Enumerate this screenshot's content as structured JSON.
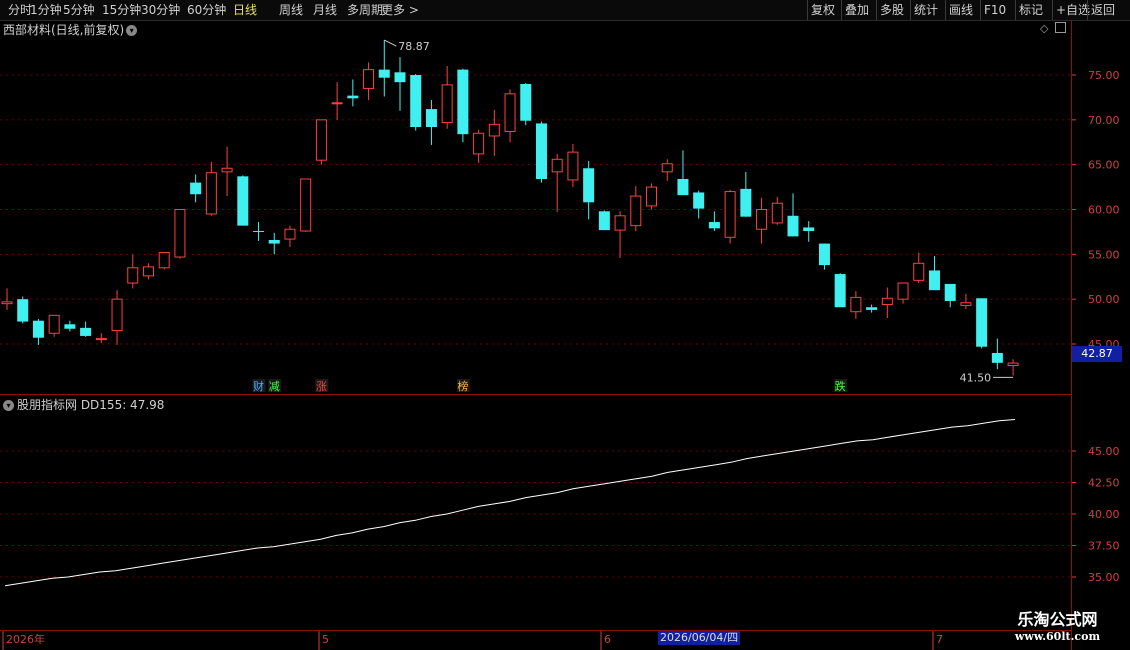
{
  "toolbar": {
    "periods": [
      "分时",
      "1分钟",
      "5分钟",
      "15分钟",
      "30分钟",
      "60分钟",
      "日线",
      "周线",
      "月线",
      "多周期",
      "更多 >"
    ],
    "active_period": "日线",
    "right_buttons": [
      "复权",
      "叠加",
      "多股",
      "统计",
      "画线",
      "F10",
      "标记",
      "+自选",
      "返回"
    ]
  },
  "stock_title": "西部材料(日线,前复权)",
  "indicator_title": "股朋指标网 DD155: 47.98",
  "current_price_tag": "42.87",
  "colors": {
    "up": "#ff4040",
    "down": "#40f0f0",
    "grid": "#6a0000",
    "axis_text": "#d04040",
    "line": "#ffffff"
  },
  "price_axis": {
    "ticks": [
      "75.00",
      "70.00",
      "65.00",
      "60.00",
      "55.00",
      "50.00",
      "45.00"
    ]
  },
  "indicator_axis": {
    "ticks": [
      "45.00",
      "42.50",
      "40.00",
      "37.50",
      "35.00"
    ]
  },
  "date_axis": {
    "labels": [
      "2026年",
      "5",
      "6",
      "7"
    ],
    "cursor_date": "2026/06/04/四"
  },
  "markers": {
    "high": "78.87",
    "low": "41.50"
  },
  "events": [
    {
      "label": "财",
      "index": 16,
      "color": "#40b0ff"
    },
    {
      "label": "减",
      "index": 17,
      "color": "#40ff40"
    },
    {
      "label": "涨",
      "index": 20,
      "color": "#ff4040"
    },
    {
      "label": "榜",
      "index": 29,
      "color": "#ffb040"
    },
    {
      "label": "跌",
      "index": 53,
      "color": "#40ff40"
    }
  ],
  "watermark": {
    "line1": "乐淘公式网",
    "line2": "www.60lt.com"
  },
  "chart_data": {
    "type": "candlestick",
    "title": "西部材料(日线,前复权)",
    "price_range": [
      41.0,
      79.5
    ],
    "ohlc": [
      [
        49.5,
        51.2,
        48.8,
        49.7
      ],
      [
        50.0,
        50.3,
        47.3,
        47.5
      ],
      [
        47.6,
        47.8,
        44.9,
        45.7
      ],
      [
        46.2,
        48.1,
        45.8,
        48.2
      ],
      [
        47.2,
        47.6,
        46.4,
        46.7
      ],
      [
        46.8,
        47.5,
        45.8,
        45.9
      ],
      [
        45.6,
        46.2,
        45.1,
        45.6
      ],
      [
        46.5,
        51.0,
        44.9,
        50.0
      ],
      [
        51.8,
        55.0,
        51.2,
        53.5
      ],
      [
        52.6,
        54.0,
        52.2,
        53.6
      ],
      [
        53.5,
        55.1,
        53.3,
        55.2
      ],
      [
        54.7,
        60.0,
        54.5,
        60.0
      ],
      [
        63.0,
        63.9,
        60.8,
        61.7
      ],
      [
        59.5,
        65.3,
        59.3,
        64.1
      ],
      [
        64.2,
        67.0,
        61.5,
        64.6
      ],
      [
        63.7,
        63.8,
        58.2,
        58.2
      ],
      [
        57.6,
        58.6,
        56.5,
        57.5
      ],
      [
        56.6,
        57.4,
        55.0,
        56.2
      ],
      [
        56.7,
        58.2,
        55.8,
        57.8
      ],
      [
        57.6,
        63.4,
        57.5,
        63.4
      ],
      [
        65.5,
        70.0,
        65.0,
        70.0
      ],
      [
        71.9,
        74.2,
        70.0,
        71.9
      ],
      [
        72.7,
        74.5,
        71.5,
        72.4
      ],
      [
        73.5,
        76.4,
        72.2,
        75.6
      ],
      [
        75.6,
        78.9,
        72.6,
        74.7
      ],
      [
        75.3,
        77.0,
        71.0,
        74.2
      ],
      [
        75.0,
        75.1,
        68.8,
        69.2
      ],
      [
        71.2,
        72.2,
        67.2,
        69.2
      ],
      [
        69.7,
        76.0,
        69.0,
        73.9
      ],
      [
        75.6,
        75.7,
        67.5,
        68.4
      ],
      [
        66.2,
        68.9,
        65.2,
        68.5
      ],
      [
        68.2,
        71.1,
        66.0,
        69.5
      ],
      [
        68.7,
        73.4,
        67.5,
        72.9
      ],
      [
        74.0,
        74.1,
        69.4,
        69.9
      ],
      [
        69.6,
        69.8,
        63.0,
        63.4
      ],
      [
        64.2,
        66.2,
        59.7,
        65.6
      ],
      [
        63.3,
        67.3,
        62.5,
        66.4
      ],
      [
        64.6,
        65.4,
        58.9,
        60.8
      ],
      [
        59.8,
        59.9,
        57.7,
        57.7
      ],
      [
        57.7,
        59.8,
        54.6,
        59.3
      ],
      [
        58.2,
        62.6,
        57.6,
        61.5
      ],
      [
        60.4,
        62.9,
        60.0,
        62.5
      ],
      [
        64.2,
        65.6,
        63.2,
        65.1
      ],
      [
        63.4,
        66.6,
        61.8,
        61.6
      ],
      [
        61.9,
        62.1,
        59.0,
        60.1
      ],
      [
        58.6,
        59.8,
        57.6,
        57.9
      ],
      [
        56.9,
        62.2,
        56.2,
        62.0
      ],
      [
        62.3,
        64.2,
        59.2,
        59.2
      ],
      [
        57.8,
        61.3,
        56.2,
        60.0
      ],
      [
        58.5,
        61.4,
        58.3,
        60.7
      ],
      [
        59.3,
        61.8,
        59.0,
        57.0
      ],
      [
        58.0,
        58.7,
        56.4,
        57.6
      ],
      [
        56.2,
        56.2,
        53.3,
        53.8
      ],
      [
        52.8,
        52.9,
        49.2,
        49.1
      ],
      [
        48.6,
        50.9,
        47.8,
        50.2
      ],
      [
        49.1,
        49.4,
        48.5,
        48.8
      ],
      [
        49.4,
        51.3,
        47.9,
        50.1
      ],
      [
        50.0,
        51.8,
        49.5,
        51.8
      ],
      [
        52.1,
        55.2,
        51.8,
        54.0
      ],
      [
        53.2,
        54.8,
        51.6,
        51.0
      ],
      [
        51.7,
        51.7,
        49.1,
        49.8
      ],
      [
        49.3,
        50.6,
        48.9,
        49.6
      ],
      [
        50.1,
        50.1,
        44.5,
        44.7
      ],
      [
        44.0,
        45.6,
        42.2,
        42.9
      ],
      [
        42.6,
        43.3,
        41.5,
        42.87
      ]
    ],
    "indicator": {
      "name": "DD155",
      "last": 47.98,
      "range": [
        33.8,
        49.1
      ],
      "values": [
        34.3,
        34.5,
        34.7,
        34.9,
        35.0,
        35.2,
        35.4,
        35.5,
        35.7,
        35.9,
        36.1,
        36.3,
        36.5,
        36.7,
        36.9,
        37.1,
        37.3,
        37.4,
        37.6,
        37.8,
        38.0,
        38.3,
        38.5,
        38.8,
        39.0,
        39.3,
        39.5,
        39.8,
        40.0,
        40.3,
        40.6,
        40.8,
        41.0,
        41.3,
        41.5,
        41.7,
        42.0,
        42.2,
        42.4,
        42.6,
        42.8,
        43.0,
        43.3,
        43.5,
        43.7,
        43.9,
        44.1,
        44.4,
        44.6,
        44.8,
        45.0,
        45.2,
        45.4,
        45.6,
        45.8,
        45.9,
        46.1,
        46.3,
        46.5,
        46.7,
        46.9,
        47.0,
        47.2,
        47.4,
        47.5
      ]
    }
  }
}
